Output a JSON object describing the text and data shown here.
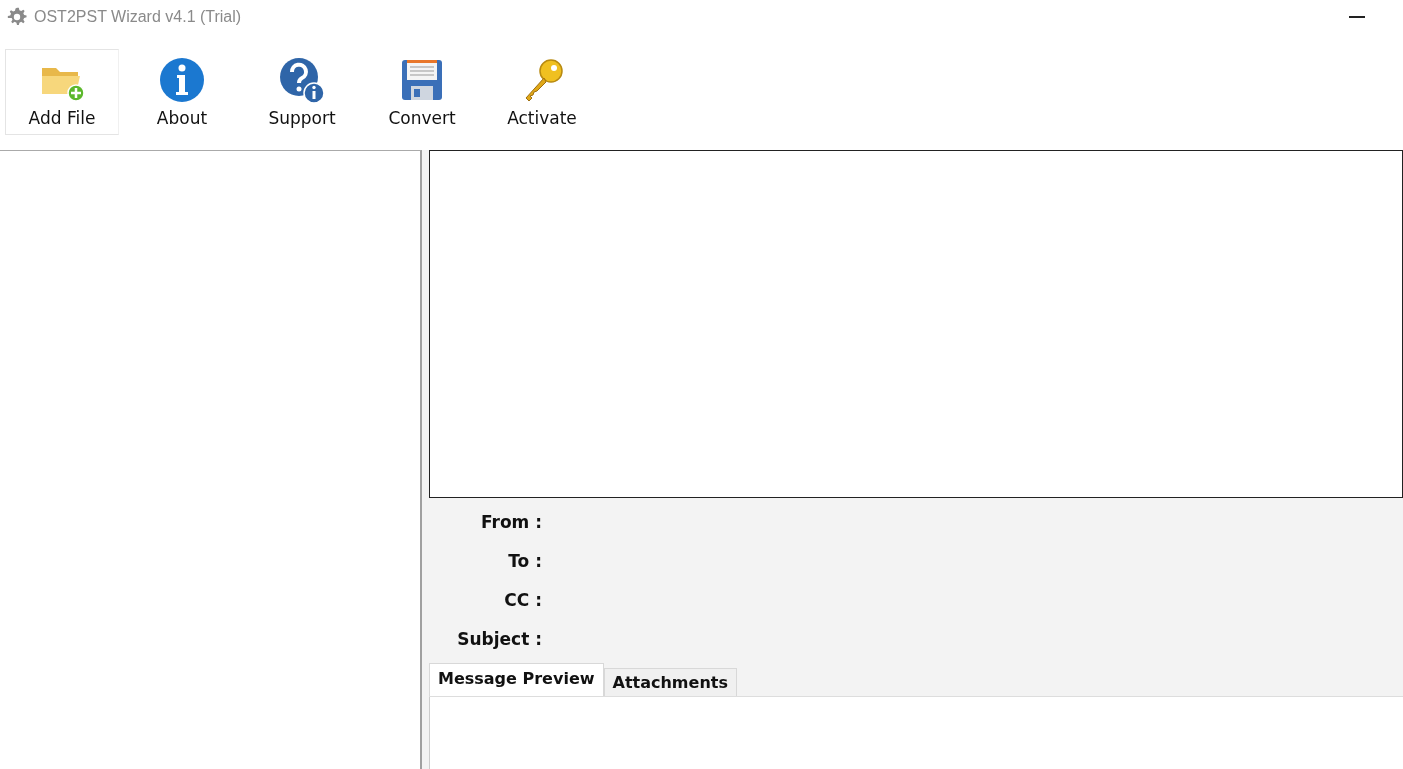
{
  "window": {
    "title": "OST2PST Wizard v4.1 (Trial)"
  },
  "toolbar": [
    {
      "label": "Add File",
      "kind": "add-file",
      "selected": true
    },
    {
      "label": "About",
      "kind": "about",
      "selected": false
    },
    {
      "label": "Support",
      "kind": "support",
      "selected": false
    },
    {
      "label": "Convert",
      "kind": "convert",
      "selected": false
    },
    {
      "label": "Activate",
      "kind": "activate",
      "selected": false
    }
  ],
  "header_fields": [
    {
      "label": "From :"
    },
    {
      "label": "To :"
    },
    {
      "label": "CC :"
    },
    {
      "label": "Subject :"
    }
  ],
  "tabs": [
    {
      "label": "Message Preview",
      "selected": true
    },
    {
      "label": "Attachments",
      "selected": false
    }
  ]
}
